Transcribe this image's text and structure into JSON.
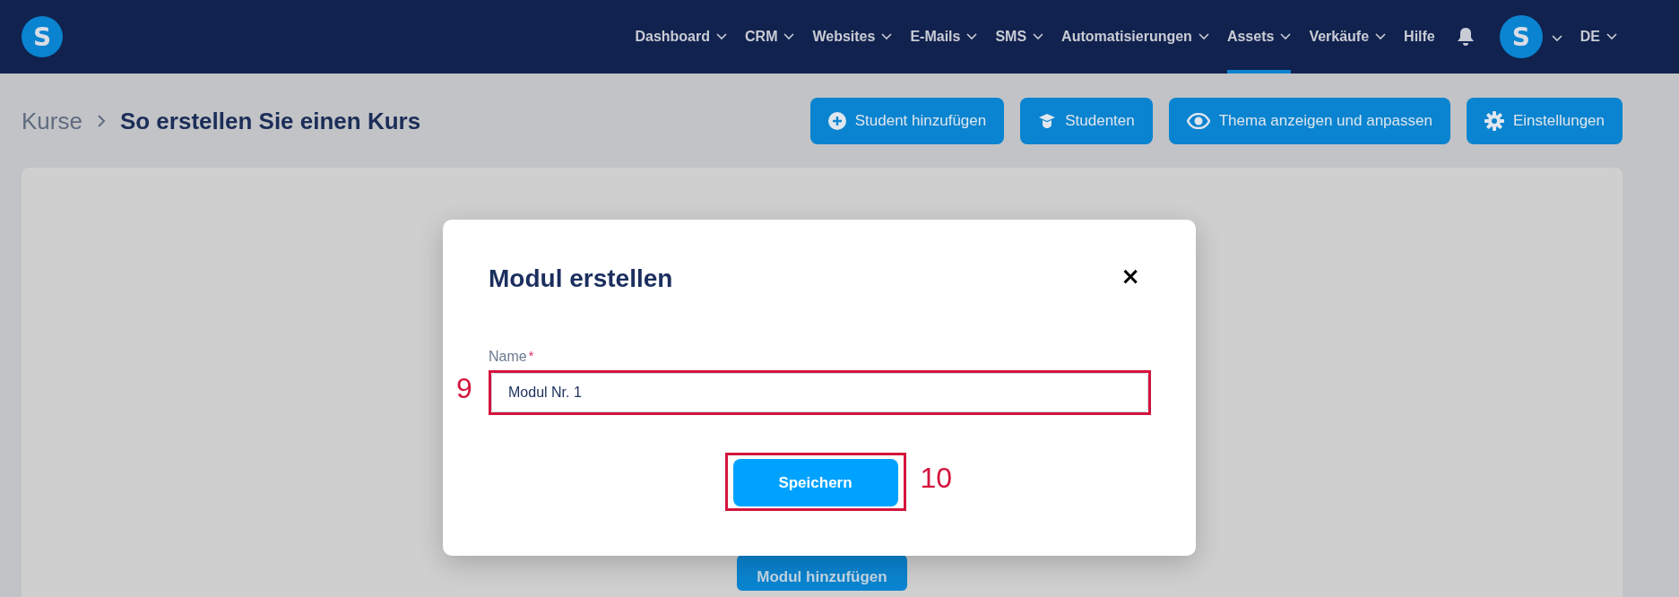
{
  "header": {
    "logo": "S",
    "nav": [
      {
        "label": "Dashboard",
        "dropdown": true,
        "selected": false
      },
      {
        "label": "CRM",
        "dropdown": true,
        "selected": false
      },
      {
        "label": "Websites",
        "dropdown": true,
        "selected": false
      },
      {
        "label": "E-Mails",
        "dropdown": true,
        "selected": false
      },
      {
        "label": "SMS",
        "dropdown": true,
        "selected": false
      },
      {
        "label": "Automatisierungen",
        "dropdown": true,
        "selected": false
      },
      {
        "label": "Assets",
        "dropdown": true,
        "selected": true
      },
      {
        "label": "Verkäufe",
        "dropdown": true,
        "selected": false
      },
      {
        "label": "Hilfe",
        "dropdown": false,
        "selected": false
      }
    ],
    "avatar": "S",
    "language": "DE"
  },
  "breadcrumb": [
    "Kurse",
    "So erstellen Sie einen Kurs"
  ],
  "actions": [
    {
      "label": "Student hinzufügen",
      "kind": "plus"
    },
    {
      "label": "Studenten",
      "kind": "cap"
    },
    {
      "label": "Thema anzeigen und anpassen",
      "kind": "eye"
    },
    {
      "label": "Einstellungen",
      "kind": "gear"
    }
  ],
  "card": {
    "button": "Modul hinzufügen"
  },
  "modal": {
    "title": "Modul erstellen",
    "close": "×",
    "field": {
      "label": "Name",
      "required_mark": "*",
      "value": "Modul Nr. 1",
      "step": "9"
    },
    "save": {
      "label": "Speichern",
      "step": "10"
    }
  }
}
